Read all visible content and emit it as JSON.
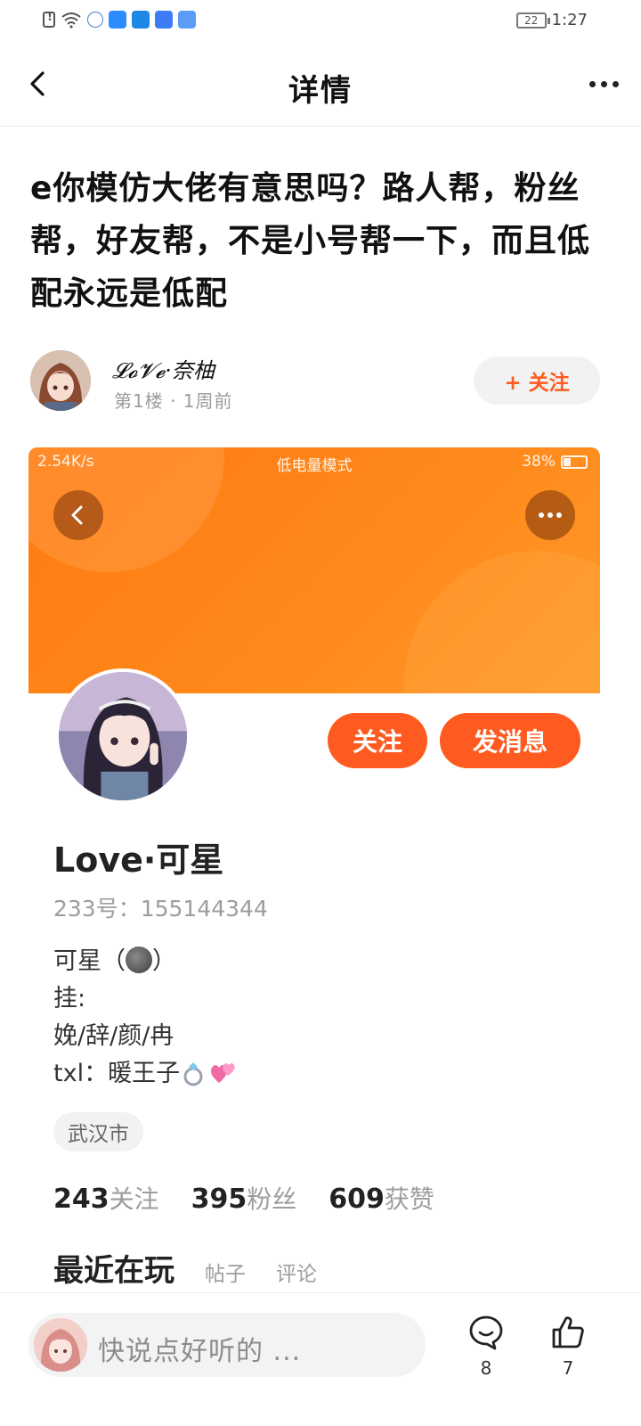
{
  "status_bar": {
    "time": "1:27",
    "battery": "22"
  },
  "header": {
    "title": "详情"
  },
  "post": {
    "title": "e你模仿大佬有意思吗？路人帮，粉丝帮，好友帮，不是小号帮一下，而且低配永远是低配"
  },
  "author": {
    "name": "𝓛𝓸𝓥𝓮·奈柚",
    "meta": "第1楼 · 1周前",
    "follow_label": "+ 关注"
  },
  "embedded": {
    "status": {
      "speed": "2.54K/s",
      "mode": "低电量模式",
      "battery": "38%"
    },
    "follow_label": "关注",
    "message_label": "发消息",
    "name": "Love·可星",
    "id": "233号：155144344",
    "bio": {
      "line1_a": "可星（",
      "line1_b": "）",
      "line2": "挂:",
      "line3": "娩/辞/颜/冉",
      "line4": "txl：暖王子"
    },
    "location": "武汉市",
    "stats": {
      "following_num": "243",
      "following_label": "关注",
      "fans_num": "395",
      "fans_label": "粉丝",
      "likes_num": "609",
      "likes_label": "获赞"
    },
    "tabs": {
      "main": "最近在玩",
      "posts": "帖子",
      "comments": "评论"
    }
  },
  "bottom": {
    "placeholder": "快说点好听的 ...",
    "comment_count": "8",
    "like_count": "7"
  },
  "colors": {
    "accent": "#ff5a1f",
    "banner": "#ff7a12"
  }
}
